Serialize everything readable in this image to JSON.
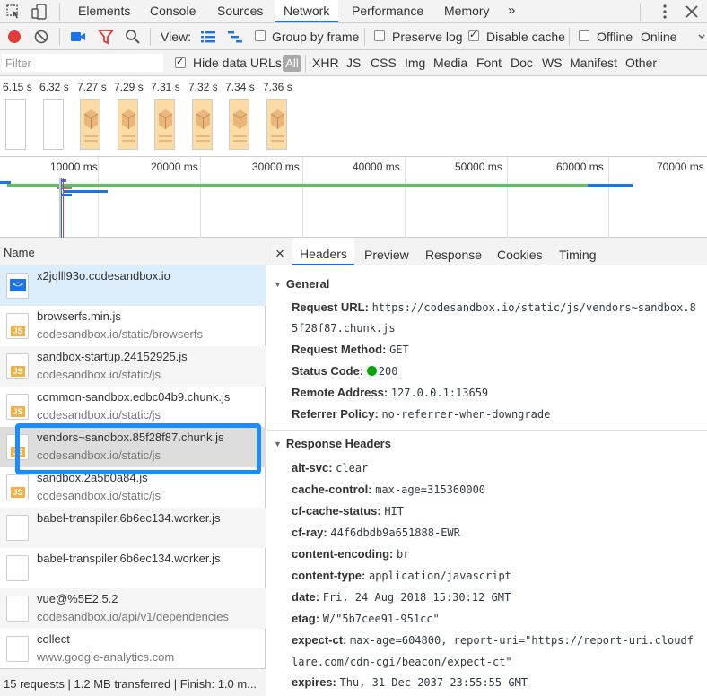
{
  "tabs": [
    "Elements",
    "Console",
    "Sources",
    "Network",
    "Performance",
    "Memory"
  ],
  "active_tab": "Network",
  "more_tabs": "»",
  "toolbar": {
    "view_label": "View:",
    "group_by_frame": "Group by frame",
    "preserve_log": "Preserve log",
    "disable_cache": "Disable cache",
    "offline": "Offline",
    "online": "Online"
  },
  "filter": {
    "placeholder": "Filter",
    "hide_data_urls": "Hide data URLs",
    "all": "All",
    "types": [
      "XHR",
      "JS",
      "CSS",
      "Img",
      "Media",
      "Font",
      "Doc",
      "WS",
      "Manifest",
      "Other"
    ]
  },
  "filmstrip": {
    "times": [
      "6.15 s",
      "6.32 s",
      "7.27 s",
      "7.29 s",
      "7.31 s",
      "7.32 s",
      "7.34 s",
      "7.36 s"
    ]
  },
  "timeline": {
    "ticks": [
      "10000 ms",
      "20000 ms",
      "30000 ms",
      "40000 ms",
      "50000 ms",
      "60000 ms",
      "70000 ms"
    ]
  },
  "list": {
    "header": "Name",
    "rows": [
      {
        "name": "x2jqlll93o.codesandbox.io",
        "path": ""
      },
      {
        "name": "browserfs.min.js",
        "path": "codesandbox.io/static/browserfs"
      },
      {
        "name": "sandbox-startup.24152925.js",
        "path": "codesandbox.io/static/js"
      },
      {
        "name": "common-sandbox.edbc04b9.chunk.js",
        "path": "codesandbox.io/static/js"
      },
      {
        "name": "vendors~sandbox.85f28f87.chunk.js",
        "path": "codesandbox.io/static/js"
      },
      {
        "name": "sandbox.2a5b0a84.js",
        "path": "codesandbox.io/static/js"
      },
      {
        "name": "babel-transpiler.6b6ec134.worker.js",
        "path": ""
      },
      {
        "name": "babel-transpiler.6b6ec134.worker.js",
        "path": ""
      },
      {
        "name": "vue@%5E2.5.2",
        "path": "codesandbox.io/api/v1/dependencies"
      },
      {
        "name": "collect",
        "path": "www.google-analytics.com"
      }
    ],
    "status": "15 requests | 1.2 MB transferred | Finish: 1.0 m..."
  },
  "details": {
    "close": "×",
    "tabs": [
      "Headers",
      "Preview",
      "Response",
      "Cookies",
      "Timing"
    ],
    "active": "Headers",
    "general_title": "General",
    "general": {
      "request_url_label": "Request URL:",
      "request_url_1": "https://codesandbox.io/static/js/vendors~sandbox.8",
      "request_url_2": "5f28f87.chunk.js",
      "method_label": "Request Method:",
      "method": "GET",
      "status_label": "Status Code:",
      "status": "200",
      "remote_label": "Remote Address:",
      "remote": "127.0.0.1:13659",
      "referrer_label": "Referrer Policy:",
      "referrer": "no-referrer-when-downgrade"
    },
    "response_title": "Response Headers",
    "response_headers": [
      {
        "k": "alt-svc:",
        "v": "clear"
      },
      {
        "k": "cache-control:",
        "v": "max-age=315360000"
      },
      {
        "k": "cf-cache-status:",
        "v": "HIT"
      },
      {
        "k": "cf-ray:",
        "v": "44f6dbdb9a651888-EWR"
      },
      {
        "k": "content-encoding:",
        "v": "br"
      },
      {
        "k": "content-type:",
        "v": "application/javascript"
      },
      {
        "k": "date:",
        "v": "Fri, 24 Aug 2018 15:30:12 GMT"
      },
      {
        "k": "etag:",
        "v": "W/\"5b7cee91-951cc\""
      },
      {
        "k": "expect-ct:",
        "v": "max-age=604800, report-uri=\"https://report-uri.cloudf"
      },
      {
        "k": "",
        "v": "lare.com/cdn-cgi/beacon/expect-ct\""
      },
      {
        "k": "expires:",
        "v": "Thu, 31 Dec 2037 23:55:55 GMT"
      }
    ]
  },
  "colors": {
    "accent": "#1a73e8",
    "record": "#e53935",
    "filter_icon": "#e53935",
    "highlight_box": "#1a8cff",
    "status_ok": "#00aa00"
  }
}
